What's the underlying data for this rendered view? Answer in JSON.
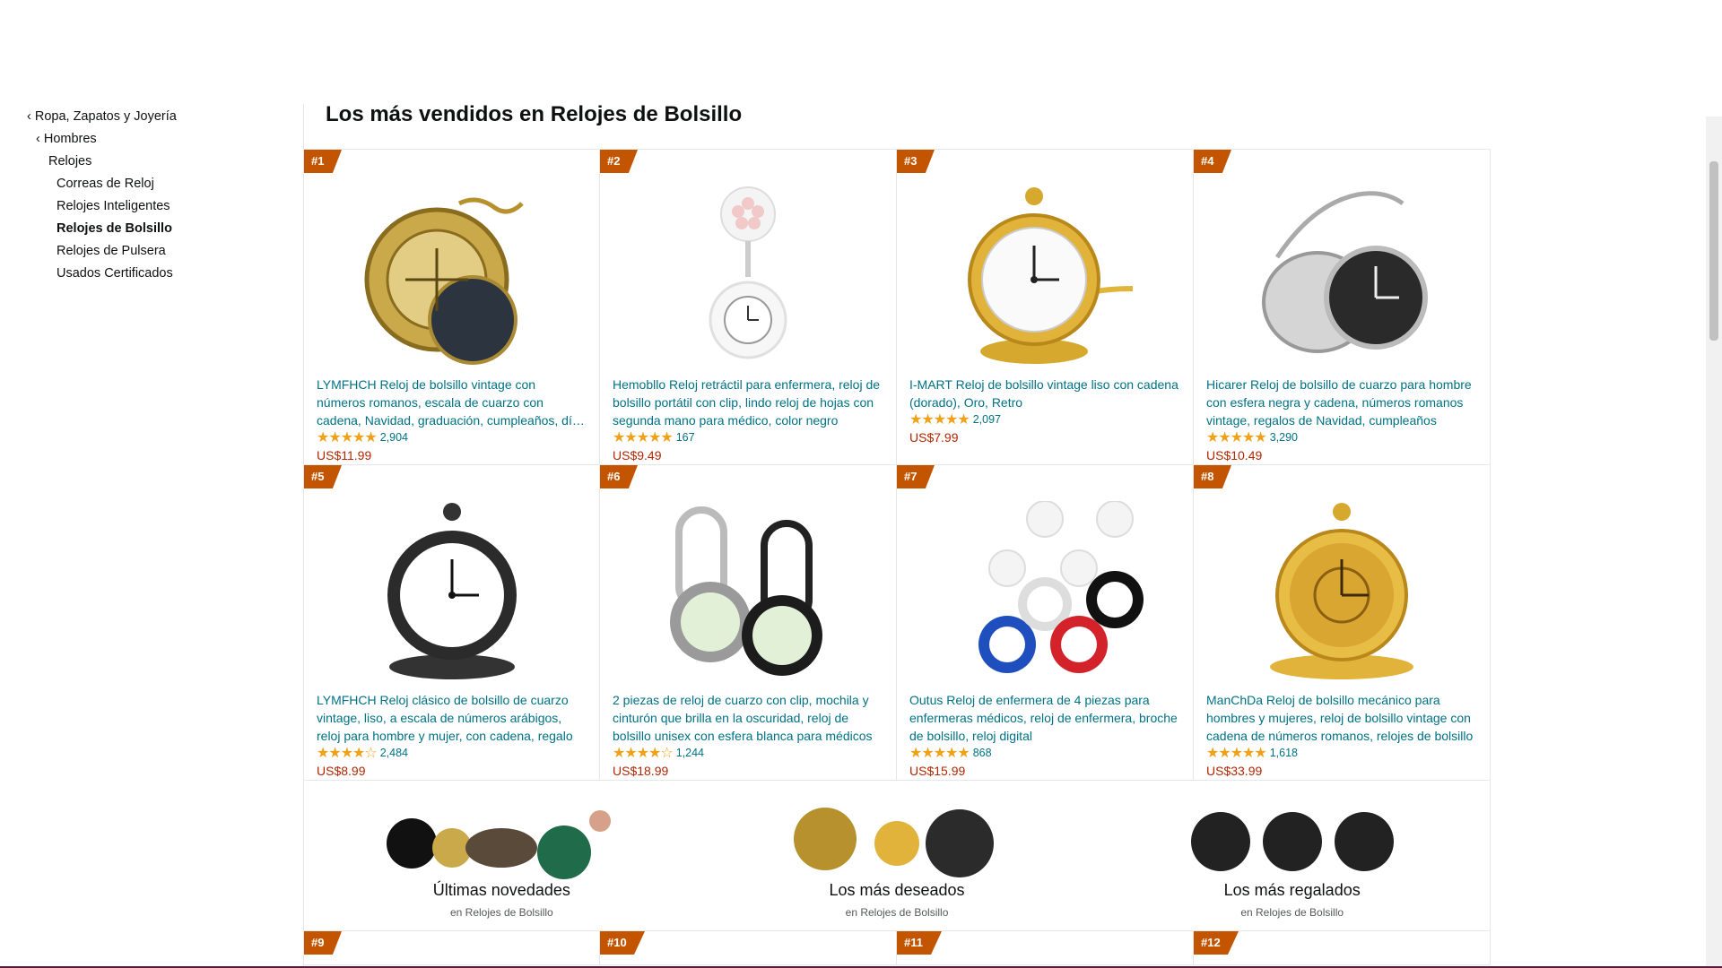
{
  "sidebar": {
    "items": [
      {
        "label": "‹ Ropa, Zapatos y Joyería"
      },
      {
        "label": "‹ Hombres"
      },
      {
        "label": "Relojes"
      },
      {
        "label": "Correas de Reloj"
      },
      {
        "label": "Relojes Inteligentes"
      },
      {
        "label": "Relojes de Bolsillo"
      },
      {
        "label": "Relojes de Pulsera"
      },
      {
        "label": "Usados Certificados"
      }
    ]
  },
  "page": {
    "title": "Los más vendidos en Relojes de Bolsillo"
  },
  "products": [
    {
      "rank": "#1",
      "title": "LYMFHCH Reloj de bolsillo vintage con números romanos, escala de cuarzo con cadena, Navidad, graduación, cumpleaños, día del padre",
      "stars": "★★★★★",
      "rating": 4.5,
      "count": "2,904",
      "price": "US$11.99"
    },
    {
      "rank": "#2",
      "title": "Hemobllo Reloj retráctil para enfermera, reloj de bolsillo portátil con clip, lindo reloj de hojas con segunda mano para médico, color negro",
      "stars": "★★★★★",
      "rating": 4.5,
      "count": "167",
      "price": "US$9.49"
    },
    {
      "rank": "#3",
      "title": "I-MART Reloj de bolsillo vintage liso con cadena (dorado), Oro, Retro",
      "stars": "★★★★★",
      "rating": 4.5,
      "count": "2,097",
      "price": "US$7.99"
    },
    {
      "rank": "#4",
      "title": "Hicarer Reloj de bolsillo de cuarzo para hombre con esfera negra y cadena, números romanos vintage, regalos de Navidad, cumpleaños",
      "stars": "★★★★★",
      "rating": 4.5,
      "count": "3,290",
      "price": "US$10.49"
    },
    {
      "rank": "#5",
      "title": "LYMFHCH Reloj clásico de bolsillo de cuarzo vintage, liso, a escala de números arábigos, reloj para hombre y mujer, con cadena, regalo",
      "stars": "★★★★☆",
      "rating": 4.0,
      "count": "2,484",
      "price": "US$8.99"
    },
    {
      "rank": "#6",
      "title": "2 piezas de reloj de cuarzo con clip, mochila y cinturón que brilla en la oscuridad, reloj de bolsillo unisex con esfera blanca para médicos",
      "stars": "★★★★☆",
      "rating": 4.0,
      "count": "1,244",
      "price": "US$18.99"
    },
    {
      "rank": "#7",
      "title": "Outus Reloj de enfermera de 4 piezas para enfermeras médicos, reloj de enfermera, broche de bolsillo, reloj digital",
      "stars": "★★★★★",
      "rating": 4.5,
      "count": "868",
      "price": "US$15.99"
    },
    {
      "rank": "#8",
      "title": "ManChDa Reloj de bolsillo mecánico para hombres y mujeres, reloj de bolsillo vintage con cadena de números romanos, relojes de bolsillo",
      "stars": "★★★★★",
      "rating": 4.5,
      "count": "1,618",
      "price": "US$33.99"
    }
  ],
  "promos": [
    {
      "title": "Últimas novedades",
      "subtitle": "en Relojes de Bolsillo"
    },
    {
      "title": "Los más deseados",
      "subtitle": "en Relojes de Bolsillo"
    },
    {
      "title": "Los más regalados",
      "subtitle": "en Relojes de Bolsillo"
    }
  ],
  "more_ranks": [
    "#9",
    "#10",
    "#11",
    "#12"
  ],
  "colors": {
    "link": "#007185",
    "price": "#b12704",
    "badge": "#c45500",
    "star": "#f0a11a"
  }
}
